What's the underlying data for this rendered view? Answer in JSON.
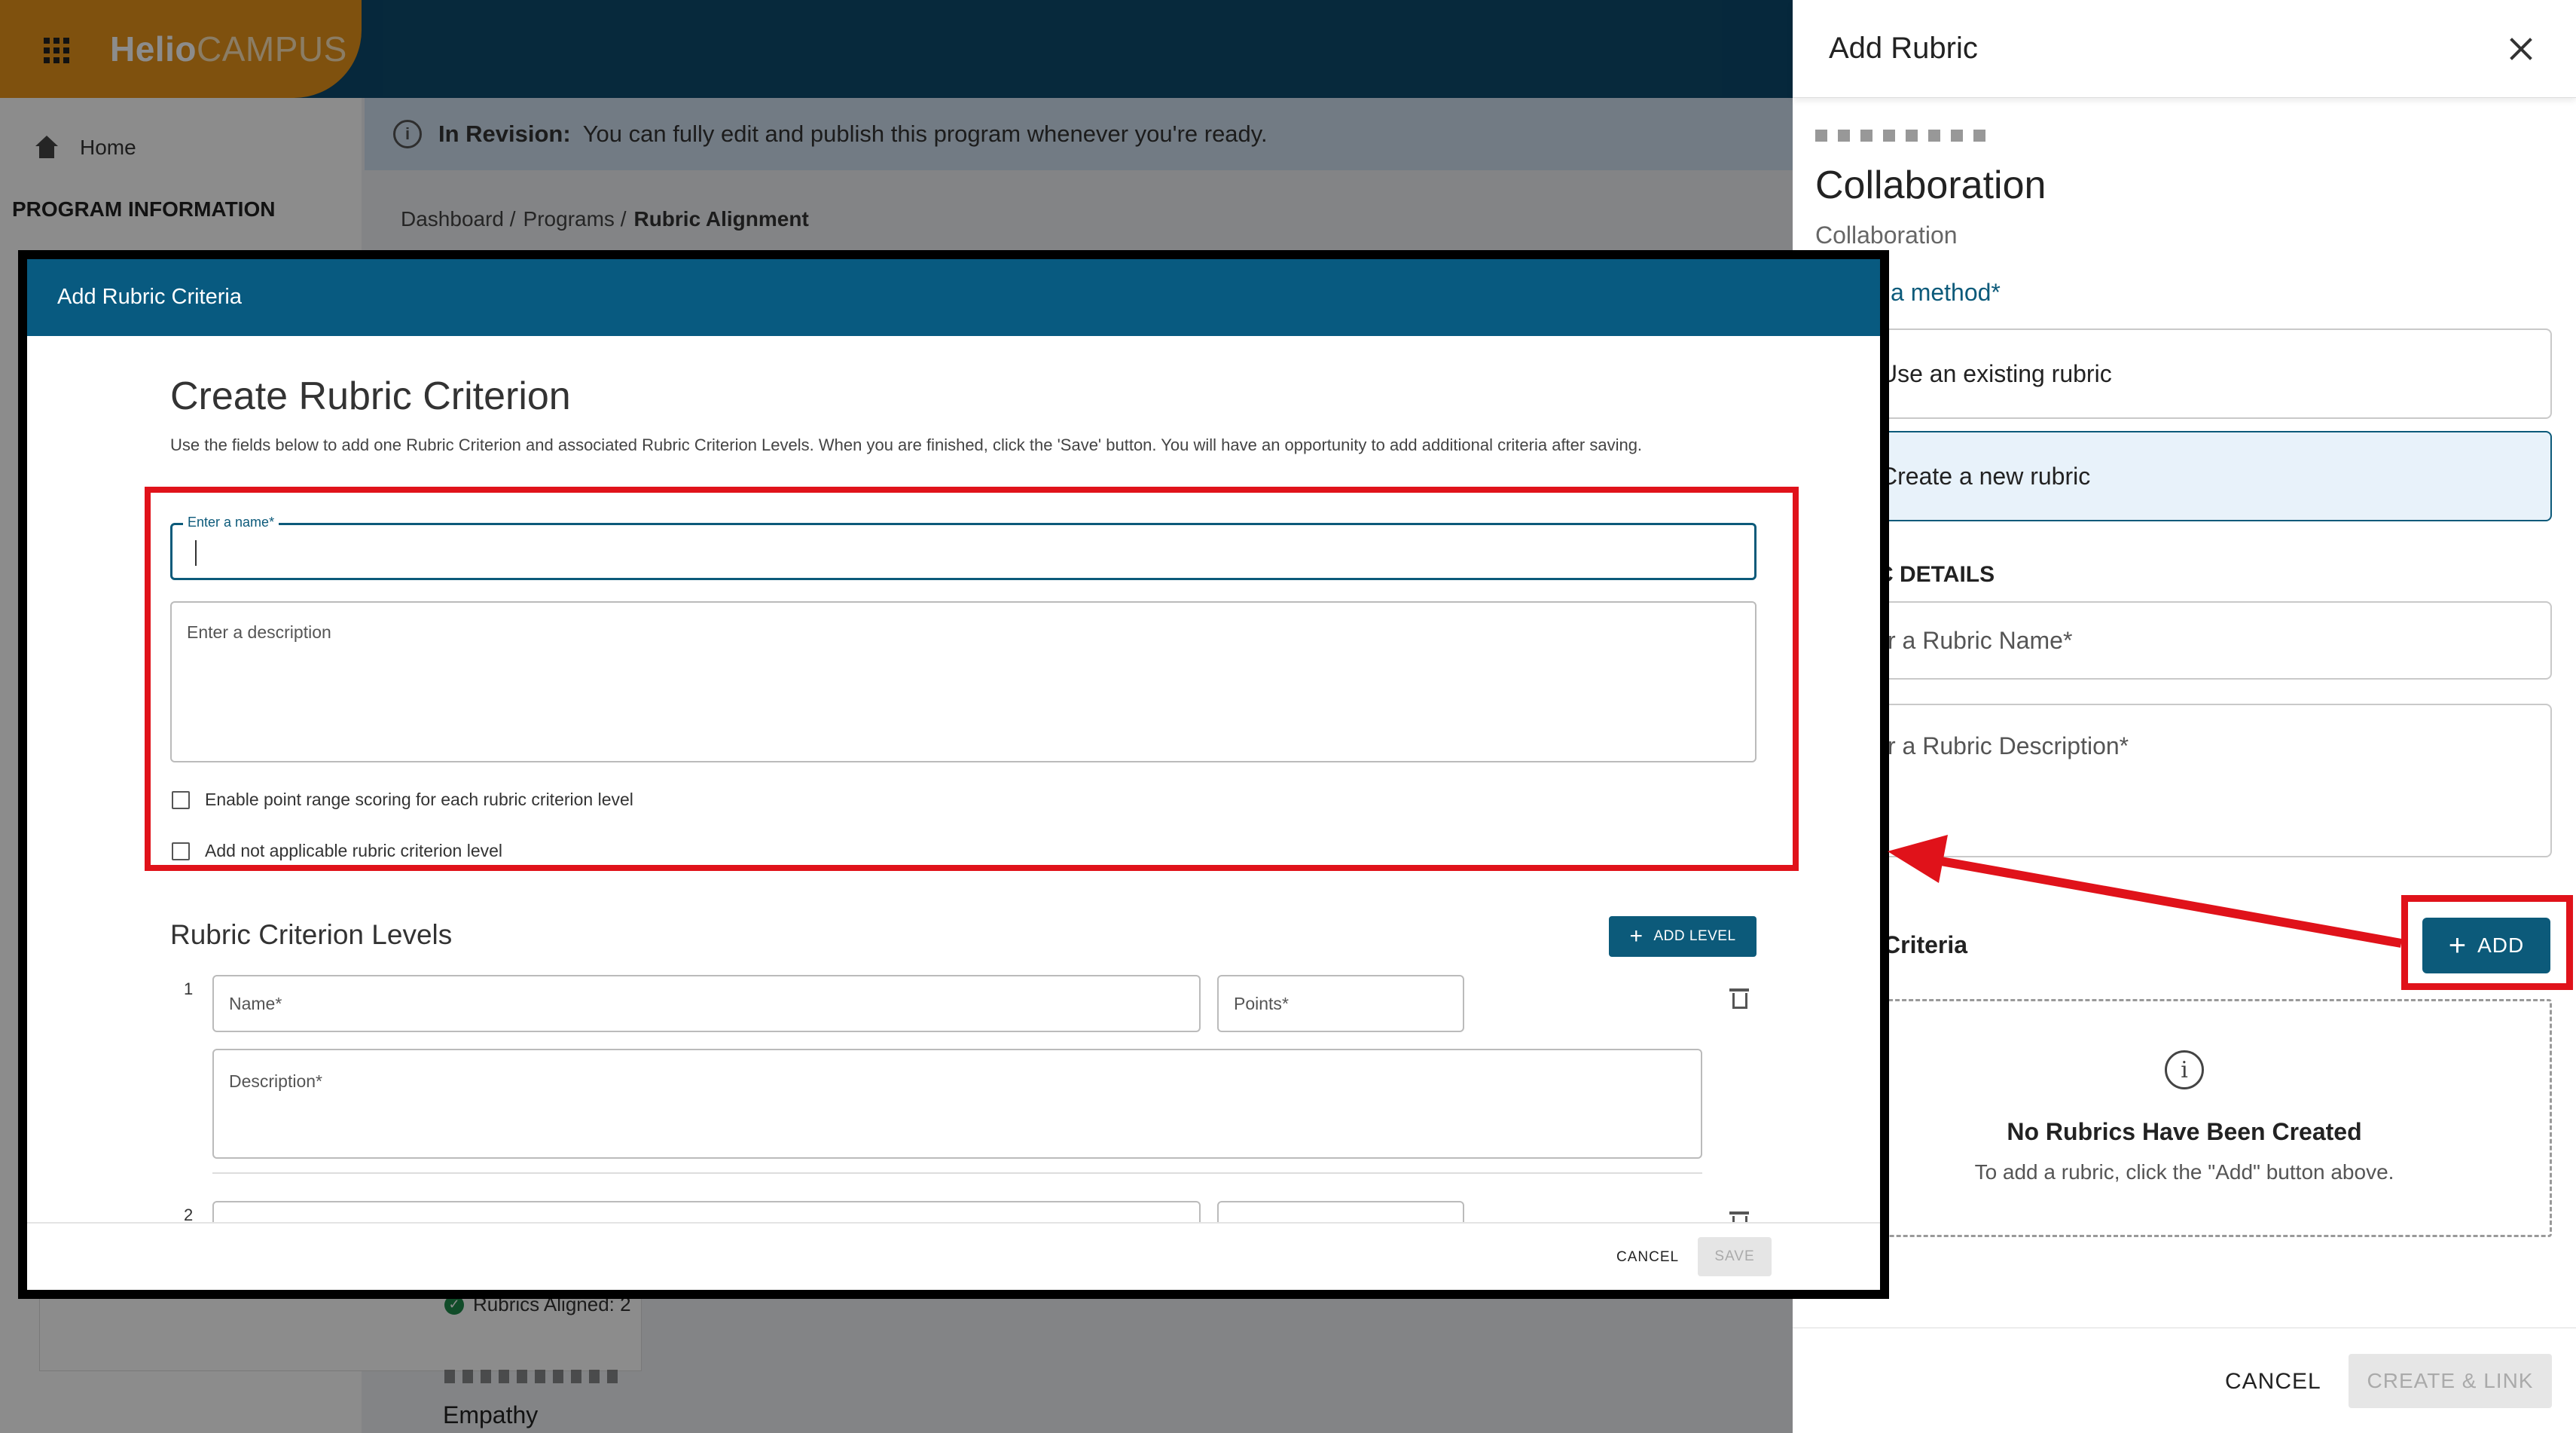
{
  "app": {
    "logo_bold": "Helio",
    "logo_light": "CAMPUS",
    "sidebar": {
      "home_label": "Home",
      "section_title": "PROGRAM INFORMATION"
    },
    "banner": {
      "label": "In Revision:",
      "text": "You can fully edit and publish this program whenever you're ready."
    },
    "breadcrumb": [
      {
        "label": "Dashboard /"
      },
      {
        "label": "Programs /"
      },
      {
        "label": "Rubric Alignment"
      }
    ],
    "list": {
      "aligned_text": "Rubrics Aligned: 2",
      "item_title": "Empathy"
    }
  },
  "drawer": {
    "title": "Add Rubric",
    "heading": "Collaboration",
    "subheading": "Collaboration",
    "method_label": "a method",
    "required_mark": "*",
    "options": [
      {
        "label": "Use an existing rubric"
      },
      {
        "label": "Create a new rubric"
      }
    ],
    "details_heading": "C DETAILS",
    "name_placeholder": "r a Rubric Name",
    "desc_placeholder": "r a Rubric Description",
    "criteria_label": "Criteria",
    "add_button": "ADD",
    "empty": {
      "icon": "info-icon",
      "title": "No Rubrics Have Been Created",
      "text": "To add a rubric, click the \"Add\" button above."
    },
    "cancel": "CANCEL",
    "create_link": "CREATE & LINK"
  },
  "modal": {
    "header": "Add Rubric Criteria",
    "title": "Create Rubric Criterion",
    "description": "Use the fields below to add one Rubric Criterion and associated Rubric Criterion Levels. When you are finished, click the 'Save' button. You will have an opportunity to add additional criteria after saving.",
    "name_label": "Enter a name",
    "desc_placeholder": "Enter a description",
    "checkboxes": [
      {
        "label": "Enable point range scoring for each rubric criterion level"
      },
      {
        "label": "Add not applicable rubric criterion level"
      }
    ],
    "levels_title": "Rubric Criterion Levels",
    "add_level": "ADD LEVEL",
    "levels": [
      {
        "number": "1",
        "name_placeholder": "Name",
        "points_placeholder": "Points",
        "desc_placeholder": "Description"
      },
      {
        "number": "2"
      }
    ],
    "cancel": "CANCEL",
    "save": "SAVE"
  },
  "colors": {
    "primary": "#0c5a7a",
    "modal_header": "#085a80",
    "annotation_red": "#e0121a",
    "logo_orange": "#e8941a"
  }
}
